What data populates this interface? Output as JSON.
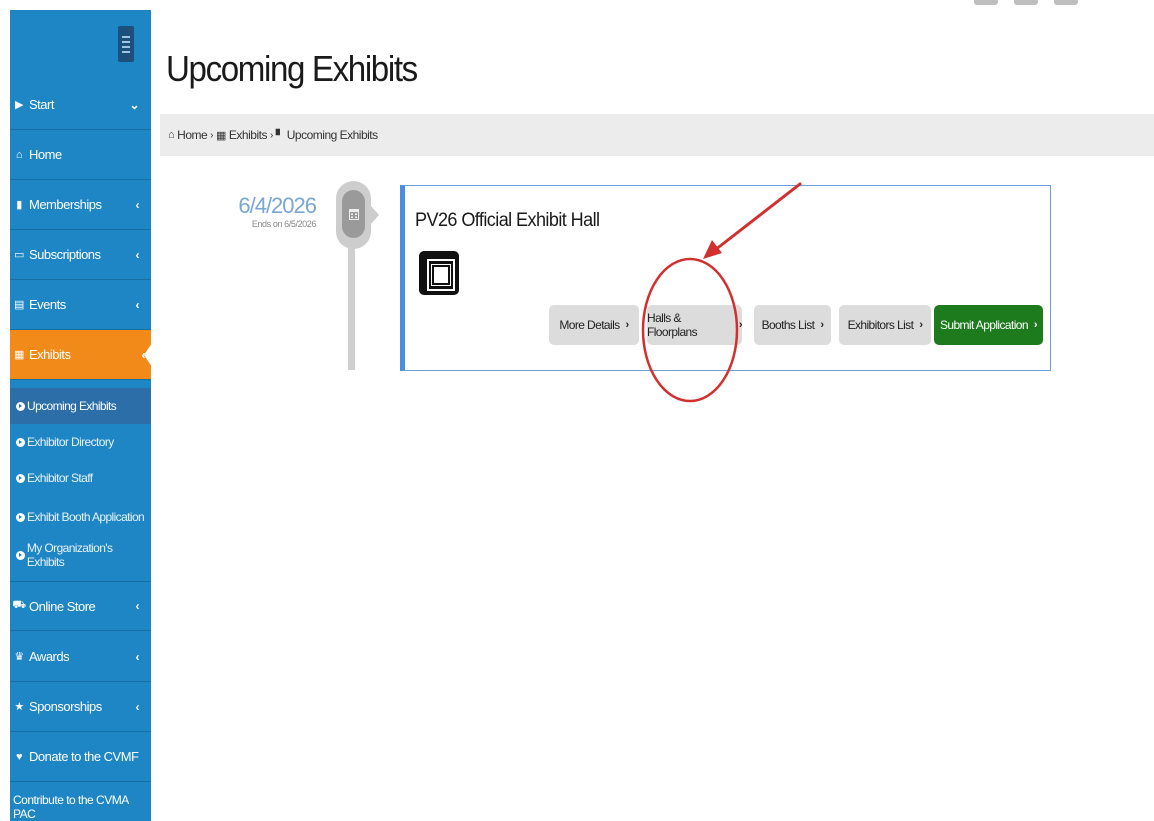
{
  "sidebar": {
    "items": [
      {
        "label": "Start",
        "icon": "play-square-icon",
        "chevron": "⌄"
      },
      {
        "label": "Home",
        "icon": "home-icon",
        "chevron": ""
      },
      {
        "label": "Memberships",
        "icon": "bookmark-icon",
        "chevron": "‹"
      },
      {
        "label": "Subscriptions",
        "icon": "hdd-icon",
        "chevron": "‹"
      },
      {
        "label": "Events",
        "icon": "calendar-icon",
        "chevron": "‹"
      },
      {
        "label": "Exhibits",
        "icon": "grid-icon",
        "chevron": "‹"
      }
    ],
    "subitems": [
      {
        "label": "Upcoming Exhibits"
      },
      {
        "label": "Exhibitor Directory"
      },
      {
        "label": "Exhibitor Staff"
      },
      {
        "label": "Exhibit Booth Application"
      },
      {
        "label": "My Organization's Exhibits"
      }
    ],
    "items_bottom": [
      {
        "label": "Online Store",
        "icon": "cart-icon",
        "chevron": "‹"
      },
      {
        "label": "Awards",
        "icon": "trophy-icon",
        "chevron": "‹"
      },
      {
        "label": "Sponsorships",
        "icon": "star-icon",
        "chevron": "‹"
      },
      {
        "label": "Donate to the CVMF",
        "icon": "heart-icon",
        "chevron": ""
      },
      {
        "label": "Contribute to the CVMA PAC",
        "icon": "",
        "chevron": ""
      }
    ]
  },
  "page": {
    "title": "Upcoming Exhibits"
  },
  "breadcrumb": {
    "home": "Home",
    "exhibits": "Exhibits",
    "current": "Upcoming Exhibits"
  },
  "exhibit": {
    "date": "6/4/2026",
    "ends": "Ends on 6/5/2026",
    "title": "PV26 Official Exhibit Hall",
    "buttons": {
      "more_details": "More Details",
      "halls": "Halls & Floorplans",
      "booths": "Booths List",
      "exhibitors": "Exhibitors List",
      "submit": "Submit Application"
    }
  },
  "colors": {
    "sidebar": "#1f86c6",
    "active_item": "#f28a1a",
    "active_subitem": "#2b6ea8",
    "submit_button": "#1d7a1d",
    "annotation": "#d22f2f"
  }
}
